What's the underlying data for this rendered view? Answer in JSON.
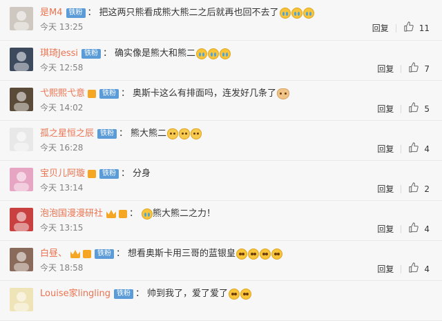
{
  "comments": [
    {
      "user": "是M4",
      "badge": "铁粉",
      "crown": false,
      "vip": false,
      "text": "把这两只熊看成熊大熊二之后就再也回不去了",
      "emojis": [
        "cry",
        "cry",
        "cry"
      ],
      "emoji_before": false,
      "time": "今天 13:25",
      "reply": "回复",
      "likes": "11",
      "avatar_color": "#cfc8c0"
    },
    {
      "user": "琪琦Jessi",
      "badge": "铁粉",
      "crown": false,
      "vip": false,
      "text": "确实像是熊大和熊二",
      "emojis": [
        "cry",
        "cry",
        "cry"
      ],
      "emoji_before": false,
      "time": "今天 12:58",
      "reply": "回复",
      "likes": "7",
      "avatar_color": "#3d4a5e"
    },
    {
      "user": "弋熙熙弋意",
      "badge": "铁粉",
      "crown": true,
      "vip": false,
      "text": "奥斯卡这么有排面吗，连发好几条了",
      "emojis": [
        "hands"
      ],
      "emoji_before": false,
      "time": "今天 14:02",
      "reply": "回复",
      "likes": "5",
      "avatar_color": "#5a4a38"
    },
    {
      "user": "孤之星恒之辰",
      "badge": "铁粉",
      "crown": false,
      "vip": false,
      "text": "熊大熊二",
      "emojis": [
        "cat",
        "cat",
        "cat"
      ],
      "emoji_before": false,
      "time": "今天 16:28",
      "reply": "回复",
      "likes": "4",
      "avatar_color": "#e8e8e8"
    },
    {
      "user": "宝贝儿阿璇",
      "badge": "铁粉",
      "crown": true,
      "vip": false,
      "text": "分身",
      "emojis": [],
      "emoji_before": false,
      "time": "今天 13:14",
      "reply": "回复",
      "likes": "2",
      "avatar_color": "#e7a5c4"
    },
    {
      "user": "泡泡国漫漫研社",
      "badge": "",
      "crown": true,
      "vip": true,
      "text": "熊大熊二之力！",
      "emojis": [
        "cry"
      ],
      "emoji_before": true,
      "time": "今天 13:15",
      "reply": "回复",
      "likes": "4",
      "avatar_color": "#c94040"
    },
    {
      "user": "白昼、",
      "badge": "铁粉",
      "crown": true,
      "vip": true,
      "text": "想看奥斯卡用三哥的蓝银皇",
      "emojis": [
        "shock",
        "shock",
        "shock",
        "shock"
      ],
      "emoji_before": false,
      "time": "今天 18:58",
      "reply": "回复",
      "likes": "4",
      "avatar_color": "#8a6a5a"
    },
    {
      "user": "Louise家lingling",
      "badge": "铁粉",
      "crown": false,
      "vip": false,
      "text": "帅到我了，爱了爱了",
      "emojis": [
        "shock",
        "shock"
      ],
      "emoji_before": false,
      "time": "",
      "reply": "",
      "likes": "",
      "avatar_color": "#efe3b8"
    }
  ],
  "icons": {
    "like": "thumbs-up-icon"
  },
  "colors": {
    "username": "#eb7350",
    "badge": "#5b9cd8",
    "crown": "#f5a623"
  }
}
